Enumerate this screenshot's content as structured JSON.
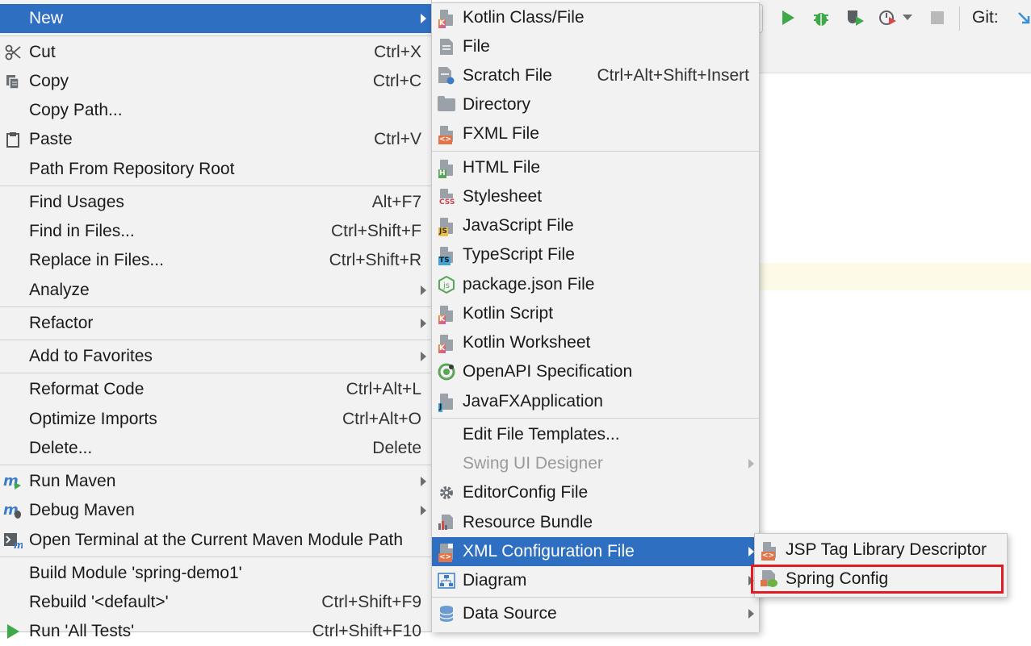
{
  "menu1": {
    "items": [
      {
        "label": "New",
        "shortcut": "",
        "icon": "",
        "submenu": true,
        "selected": true
      },
      {
        "label": "Cut",
        "shortcut": "Ctrl+X",
        "icon": "scissors-icon"
      },
      {
        "label": "Copy",
        "shortcut": "Ctrl+C",
        "icon": "copy-icon"
      },
      {
        "label": "Copy Path...",
        "shortcut": ""
      },
      {
        "label": "Paste",
        "shortcut": "Ctrl+V",
        "icon": "clipboard-icon"
      },
      {
        "label": "Path From Repository Root",
        "shortcut": ""
      },
      {
        "label": "Find Usages",
        "shortcut": "Alt+F7"
      },
      {
        "label": "Find in Files...",
        "shortcut": "Ctrl+Shift+F"
      },
      {
        "label": "Replace in Files...",
        "shortcut": "Ctrl+Shift+R"
      },
      {
        "label": "Analyze",
        "shortcut": "",
        "submenu": true
      },
      {
        "label": "Refactor",
        "shortcut": "",
        "submenu": true
      },
      {
        "label": "Add to Favorites",
        "shortcut": "",
        "submenu": true
      },
      {
        "label": "Reformat Code",
        "shortcut": "Ctrl+Alt+L"
      },
      {
        "label": "Optimize Imports",
        "shortcut": "Ctrl+Alt+O"
      },
      {
        "label": "Delete...",
        "shortcut": "Delete"
      },
      {
        "label": "Run Maven",
        "shortcut": "",
        "icon": "maven-run-icon",
        "submenu": true
      },
      {
        "label": "Debug Maven",
        "shortcut": "",
        "icon": "maven-debug-icon",
        "submenu": true
      },
      {
        "label": "Open Terminal at the Current Maven Module Path",
        "shortcut": "",
        "icon": "terminal-icon"
      },
      {
        "label": "Build Module 'spring-demo1'",
        "shortcut": ""
      },
      {
        "label": "Rebuild '<default>'",
        "shortcut": "Ctrl+Shift+F9"
      },
      {
        "label": "Run 'All Tests'",
        "shortcut": "Ctrl+Shift+F10",
        "icon": "run-icon"
      }
    ]
  },
  "menu2": {
    "items": [
      {
        "label": "Kotlin Class/File",
        "icon": "kotlin-file-icon"
      },
      {
        "label": "File",
        "icon": "text-file-icon"
      },
      {
        "label": "Scratch File",
        "shortcut": "Ctrl+Alt+Shift+Insert",
        "icon": "scratch-file-icon"
      },
      {
        "label": "Directory",
        "icon": "folder-icon"
      },
      {
        "label": "FXML File",
        "icon": "fxml-file-icon"
      },
      {
        "label": "HTML File",
        "icon": "html-file-icon"
      },
      {
        "label": "Stylesheet",
        "icon": "css-file-icon"
      },
      {
        "label": "JavaScript File",
        "icon": "js-file-icon"
      },
      {
        "label": "TypeScript File",
        "icon": "ts-file-icon"
      },
      {
        "label": "package.json File",
        "icon": "nodejs-icon"
      },
      {
        "label": "Kotlin Script",
        "icon": "kotlin-script-icon"
      },
      {
        "label": "Kotlin Worksheet",
        "icon": "kotlin-worksheet-icon"
      },
      {
        "label": "OpenAPI Specification",
        "icon": "openapi-icon"
      },
      {
        "label": "JavaFXApplication",
        "icon": "javafx-file-icon"
      },
      {
        "label": "Edit File Templates..."
      },
      {
        "label": "Swing UI Designer",
        "submenu": true,
        "disabled": true
      },
      {
        "label": "EditorConfig File",
        "icon": "gear-icon"
      },
      {
        "label": "Resource Bundle",
        "icon": "resource-bundle-icon"
      },
      {
        "label": "XML Configuration File",
        "icon": "xml-file-icon",
        "submenu": true,
        "selected": true
      },
      {
        "label": "Diagram",
        "icon": "diagram-icon",
        "submenu": true
      },
      {
        "label": "Data Source",
        "icon": "database-icon",
        "submenu": true
      }
    ]
  },
  "menu3": {
    "items": [
      {
        "label": "JSP Tag Library Descriptor",
        "icon": "xml-file-icon"
      },
      {
        "label": "Spring Config",
        "icon": "spring-file-icon"
      }
    ]
  },
  "toolbar": {
    "git_label": "Git:"
  },
  "colors": {
    "selection": "#2f6fc1",
    "menu_bg": "#f2f2f2",
    "highlight_border": "#e01b24"
  }
}
